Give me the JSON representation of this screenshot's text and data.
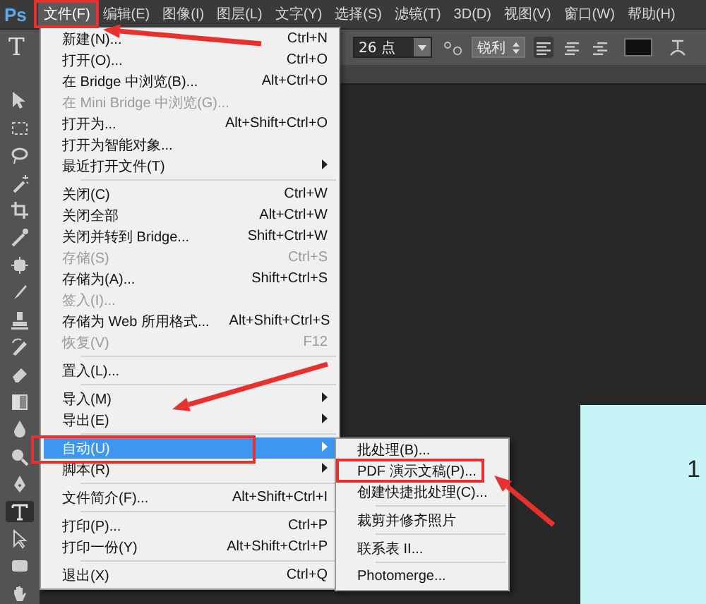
{
  "app": {
    "logo": "Ps"
  },
  "menubar": [
    {
      "label": "文件(F)",
      "selected": true
    },
    {
      "label": "编辑(E)",
      "selected": false
    },
    {
      "label": "图像(I)",
      "selected": false
    },
    {
      "label": "图层(L)",
      "selected": false
    },
    {
      "label": "文字(Y)",
      "selected": false
    },
    {
      "label": "选择(S)",
      "selected": false
    },
    {
      "label": "滤镜(T)",
      "selected": false
    },
    {
      "label": "3D(D)",
      "selected": false
    },
    {
      "label": "视图(V)",
      "selected": false
    },
    {
      "label": "窗口(W)",
      "selected": false
    },
    {
      "label": "帮助(H)",
      "selected": false
    }
  ],
  "options_bar": {
    "tool_glyph": "T",
    "font_size": "26 点",
    "anti_alias": "锐利",
    "alignments": [
      {
        "kind": "left",
        "selected": true
      },
      {
        "kind": "center",
        "selected": false
      },
      {
        "kind": "right",
        "selected": false
      }
    ]
  },
  "tools": [
    {
      "kind": "move",
      "selected": false
    },
    {
      "kind": "marquee",
      "selected": false
    },
    {
      "kind": "lasso",
      "selected": false
    },
    {
      "kind": "wand",
      "selected": false
    },
    {
      "kind": "crop",
      "selected": false
    },
    {
      "kind": "eyedropper",
      "selected": false
    },
    {
      "kind": "healing",
      "selected": false
    },
    {
      "kind": "brush",
      "selected": false
    },
    {
      "kind": "stamp",
      "selected": false
    },
    {
      "kind": "history",
      "selected": false
    },
    {
      "kind": "eraser",
      "selected": false
    },
    {
      "kind": "gradient",
      "selected": false
    },
    {
      "kind": "blur",
      "selected": false
    },
    {
      "kind": "dodge",
      "selected": false
    },
    {
      "kind": "pen",
      "selected": false
    },
    {
      "kind": "type",
      "selected": true
    },
    {
      "kind": "path",
      "selected": false
    },
    {
      "kind": "shape",
      "selected": false
    },
    {
      "kind": "hand",
      "selected": false
    }
  ],
  "file_menu": [
    {
      "kind": "item",
      "label": "新建(N)...",
      "shortcut": "Ctrl+N",
      "disabled": false,
      "has_submenu": false,
      "selected": false
    },
    {
      "kind": "item",
      "label": "打开(O)...",
      "shortcut": "Ctrl+O",
      "disabled": false,
      "has_submenu": false,
      "selected": false
    },
    {
      "kind": "item",
      "label": "在 Bridge 中浏览(B)...",
      "shortcut": "Alt+Ctrl+O",
      "disabled": false,
      "has_submenu": false,
      "selected": false
    },
    {
      "kind": "item",
      "label": "在 Mini Bridge 中浏览(G)...",
      "disabled": true,
      "has_submenu": false,
      "selected": false
    },
    {
      "kind": "item",
      "label": "打开为...",
      "shortcut": "Alt+Shift+Ctrl+O",
      "disabled": false,
      "has_submenu": false,
      "selected": false
    },
    {
      "kind": "item",
      "label": "打开为智能对象...",
      "disabled": false,
      "has_submenu": false,
      "selected": false
    },
    {
      "kind": "item",
      "label": "最近打开文件(T)",
      "disabled": false,
      "has_submenu": true,
      "selected": false
    },
    {
      "kind": "separator"
    },
    {
      "kind": "item",
      "label": "关闭(C)",
      "shortcut": "Ctrl+W",
      "disabled": false,
      "has_submenu": false,
      "selected": false
    },
    {
      "kind": "item",
      "label": "关闭全部",
      "shortcut": "Alt+Ctrl+W",
      "disabled": false,
      "has_submenu": false,
      "selected": false
    },
    {
      "kind": "item",
      "label": "关闭并转到 Bridge...",
      "shortcut": "Shift+Ctrl+W",
      "disabled": false,
      "has_submenu": false,
      "selected": false
    },
    {
      "kind": "item",
      "label": "存储(S)",
      "shortcut": "Ctrl+S",
      "disabled": true,
      "has_submenu": false,
      "selected": false
    },
    {
      "kind": "item",
      "label": "存储为(A)...",
      "shortcut": "Shift+Ctrl+S",
      "disabled": false,
      "has_submenu": false,
      "selected": false
    },
    {
      "kind": "item",
      "label": "签入(I)...",
      "disabled": true,
      "has_submenu": false,
      "selected": false
    },
    {
      "kind": "item",
      "label": "存储为 Web 所用格式...",
      "shortcut": "Alt+Shift+Ctrl+S",
      "disabled": false,
      "has_submenu": false,
      "selected": false
    },
    {
      "kind": "item",
      "label": "恢复(V)",
      "shortcut": "F12",
      "disabled": true,
      "has_submenu": false,
      "selected": false
    },
    {
      "kind": "separator"
    },
    {
      "kind": "item",
      "label": "置入(L)...",
      "disabled": false,
      "has_submenu": false,
      "selected": false
    },
    {
      "kind": "separator"
    },
    {
      "kind": "item",
      "label": "导入(M)",
      "disabled": false,
      "has_submenu": true,
      "selected": false
    },
    {
      "kind": "item",
      "label": "导出(E)",
      "disabled": false,
      "has_submenu": true,
      "selected": false
    },
    {
      "kind": "separator"
    },
    {
      "kind": "item",
      "label": "自动(U)",
      "disabled": false,
      "has_submenu": true,
      "selected": true
    },
    {
      "kind": "item",
      "label": "脚本(R)",
      "disabled": false,
      "has_submenu": true,
      "selected": false
    },
    {
      "kind": "separator"
    },
    {
      "kind": "item",
      "label": "文件简介(F)...",
      "shortcut": "Alt+Shift+Ctrl+I",
      "disabled": false,
      "has_submenu": false,
      "selected": false
    },
    {
      "kind": "separator"
    },
    {
      "kind": "item",
      "label": "打印(P)...",
      "shortcut": "Ctrl+P",
      "disabled": false,
      "has_submenu": false,
      "selected": false
    },
    {
      "kind": "item",
      "label": "打印一份(Y)",
      "shortcut": "Alt+Shift+Ctrl+P",
      "disabled": false,
      "has_submenu": false,
      "selected": false
    },
    {
      "kind": "separator"
    },
    {
      "kind": "item",
      "label": "退出(X)",
      "shortcut": "Ctrl+Q",
      "disabled": false,
      "has_submenu": false,
      "selected": false
    }
  ],
  "automate_submenu": [
    {
      "kind": "item",
      "label": "批处理(B)...",
      "disabled": false,
      "has_submenu": false,
      "selected": false
    },
    {
      "kind": "item",
      "label": "PDF 演示文稿(P)...",
      "disabled": false,
      "has_submenu": false,
      "selected": false
    },
    {
      "kind": "item",
      "label": "创建快捷批处理(C)...",
      "disabled": false,
      "has_submenu": false,
      "selected": false
    },
    {
      "kind": "separator"
    },
    {
      "kind": "item",
      "label": "裁剪并修齐照片",
      "disabled": false,
      "has_submenu": false,
      "selected": false
    },
    {
      "kind": "separator"
    },
    {
      "kind": "item",
      "label": "联系表 II...",
      "disabled": false,
      "has_submenu": false,
      "selected": false
    },
    {
      "kind": "separator"
    },
    {
      "kind": "item",
      "label": "Photomerge...",
      "disabled": false,
      "has_submenu": false,
      "selected": false
    }
  ],
  "canvas": {
    "text": "1"
  }
}
